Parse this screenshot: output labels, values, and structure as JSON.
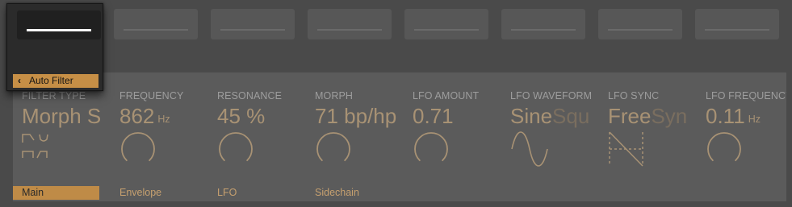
{
  "device": {
    "name": "Auto Filter",
    "back_glyph": "‹"
  },
  "params": [
    {
      "id": "filter-type",
      "label": "FILTER TYPE",
      "value": "Morph S",
      "unit": "",
      "dim": ""
    },
    {
      "id": "frequency",
      "label": "FREQUENCY",
      "value": "862",
      "unit": "Hz",
      "dim": ""
    },
    {
      "id": "resonance",
      "label": "RESONANCE",
      "value": "45 %",
      "unit": "",
      "dim": ""
    },
    {
      "id": "morph",
      "label": "MORPH",
      "value": "71 bp/hp",
      "unit": "",
      "dim": ""
    },
    {
      "id": "lfo-amount",
      "label": "LFO AMOUNT",
      "value": "0.71",
      "unit": "",
      "dim": ""
    },
    {
      "id": "lfo-waveform",
      "label": "LFO WAVEFORM",
      "value": "Sine",
      "unit": "",
      "dim": "Squ"
    },
    {
      "id": "lfo-sync",
      "label": "LFO SYNC",
      "value": "Free",
      "unit": "",
      "dim": "Syn"
    },
    {
      "id": "lfo-frequency",
      "label": "LFO FREQUENCY",
      "value": "0.11",
      "unit": "Hz",
      "dim": ""
    }
  ],
  "knob_levels": {
    "frequency": 0.78,
    "resonance": 0.45,
    "morph": 0.71,
    "lfo-amount": 0.71,
    "lfo-frequency": 0.2
  },
  "banks": [
    {
      "label": "Main",
      "active": true
    },
    {
      "label": "Envelope",
      "active": false
    },
    {
      "label": "LFO",
      "active": false
    },
    {
      "label": "Sidechain",
      "active": false
    }
  ],
  "colors": {
    "accent": "#c68f46",
    "value": "#a89274",
    "label": "#9d9d9d",
    "panel": "#5b5b5b",
    "background": "#4a4a4a"
  }
}
